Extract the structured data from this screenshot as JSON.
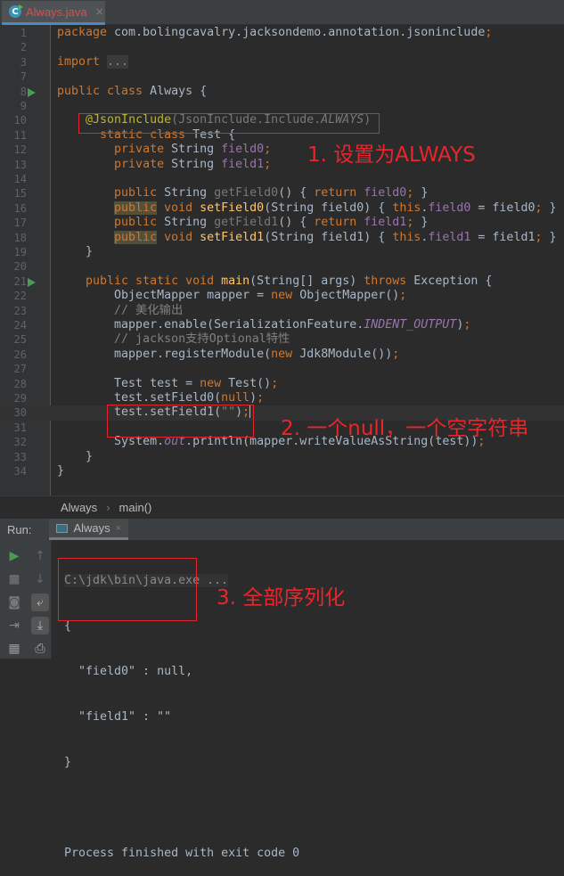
{
  "tab": {
    "filename": "Always.java",
    "close": "×",
    "icon": "class-icon"
  },
  "editor": {
    "lines": [
      {
        "n": "1",
        "t": [
          [
            "package ",
            "k"
          ],
          [
            "com.bolingcavalry.jacksondemo.annotation.jsoninclude",
            "d"
          ],
          [
            ";",
            "k"
          ]
        ]
      },
      {
        "n": "2",
        "t": []
      },
      {
        "n": "3",
        "t": [
          [
            "import ",
            "k"
          ],
          [
            "...",
            "fold"
          ]
        ]
      },
      {
        "n": "7",
        "t": []
      },
      {
        "n": "8",
        "run": true,
        "t": [
          [
            "public class ",
            "k"
          ],
          [
            "Always {",
            "d"
          ]
        ]
      },
      {
        "n": "9",
        "t": []
      },
      {
        "n": "10",
        "t": [
          [
            "    ",
            "d"
          ],
          [
            "@JsonInclude",
            "a"
          ],
          [
            "(JsonInclude.Include.",
            "g"
          ],
          [
            "ALWAYS",
            "gi"
          ],
          [
            ")",
            "g"
          ]
        ]
      },
      {
        "n": "11",
        "t": [
          [
            "      static class ",
            "k"
          ],
          [
            "Test {",
            "d"
          ]
        ]
      },
      {
        "n": "12",
        "t": [
          [
            "        private ",
            "k"
          ],
          [
            "String ",
            "d"
          ],
          [
            "field0",
            "f"
          ],
          [
            ";",
            "k"
          ]
        ]
      },
      {
        "n": "13",
        "t": [
          [
            "        private ",
            "k"
          ],
          [
            "String ",
            "d"
          ],
          [
            "field1",
            "f"
          ],
          [
            ";",
            "k"
          ]
        ]
      },
      {
        "n": "14",
        "t": []
      },
      {
        "n": "15",
        "t": [
          [
            "        public ",
            "k"
          ],
          [
            "String ",
            "d"
          ],
          [
            "getField0",
            "g"
          ],
          [
            "() { ",
            "d"
          ],
          [
            "return ",
            "k"
          ],
          [
            "field0",
            "f"
          ],
          [
            "; ",
            "k"
          ],
          [
            "}",
            "d"
          ]
        ]
      },
      {
        "n": "16",
        "t": [
          [
            "        ",
            "d"
          ],
          [
            "public",
            "k hl"
          ],
          [
            " void ",
            "k"
          ],
          [
            "setField0",
            "m"
          ],
          [
            "(String field0) { ",
            "d"
          ],
          [
            "this",
            "k"
          ],
          [
            ".",
            "d"
          ],
          [
            "field0",
            "f"
          ],
          [
            " = field0",
            "d"
          ],
          [
            "; ",
            "k"
          ],
          [
            "}",
            "d"
          ]
        ]
      },
      {
        "n": "17",
        "t": [
          [
            "        public ",
            "k"
          ],
          [
            "String ",
            "d"
          ],
          [
            "getField1",
            "g"
          ],
          [
            "() { ",
            "d"
          ],
          [
            "return ",
            "k"
          ],
          [
            "field1",
            "f"
          ],
          [
            "; ",
            "k"
          ],
          [
            "}",
            "d"
          ]
        ]
      },
      {
        "n": "18",
        "t": [
          [
            "        ",
            "d"
          ],
          [
            "public",
            "k hl"
          ],
          [
            " void ",
            "k"
          ],
          [
            "setField1",
            "m"
          ],
          [
            "(String field1) { ",
            "d"
          ],
          [
            "this",
            "k"
          ],
          [
            ".",
            "d"
          ],
          [
            "field1",
            "f"
          ],
          [
            " = field1",
            "d"
          ],
          [
            "; ",
            "k"
          ],
          [
            "}",
            "d"
          ]
        ]
      },
      {
        "n": "19",
        "t": [
          [
            "    }",
            "d"
          ]
        ]
      },
      {
        "n": "20",
        "t": []
      },
      {
        "n": "21",
        "run": true,
        "t": [
          [
            "    public static void ",
            "k"
          ],
          [
            "main",
            "m"
          ],
          [
            "(String[] args) ",
            "d"
          ],
          [
            "throws ",
            "k"
          ],
          [
            "Exception {",
            "d"
          ]
        ]
      },
      {
        "n": "22",
        "t": [
          [
            "        ObjectMapper mapper = ",
            "d"
          ],
          [
            "new ",
            "k"
          ],
          [
            "ObjectMapper()",
            "d"
          ],
          [
            ";",
            "k"
          ]
        ]
      },
      {
        "n": "23",
        "t": [
          [
            "        // 美化输出",
            "c"
          ]
        ]
      },
      {
        "n": "24",
        "t": [
          [
            "        mapper.enable(SerializationFeature.",
            "d"
          ],
          [
            "INDENT_OUTPUT",
            "fi"
          ],
          [
            ")",
            "d"
          ],
          [
            ";",
            "k"
          ]
        ]
      },
      {
        "n": "25",
        "t": [
          [
            "        // jackson支持Optional特性",
            "c"
          ]
        ]
      },
      {
        "n": "26",
        "t": [
          [
            "        mapper.registerModule(",
            "d"
          ],
          [
            "new ",
            "k"
          ],
          [
            "Jdk8Module())",
            "d"
          ],
          [
            ";",
            "k"
          ]
        ]
      },
      {
        "n": "27",
        "t": []
      },
      {
        "n": "28",
        "t": [
          [
            "        Test test = ",
            "d"
          ],
          [
            "new ",
            "k"
          ],
          [
            "Test()",
            "d"
          ],
          [
            ";",
            "k"
          ]
        ]
      },
      {
        "n": "29",
        "t": [
          [
            "        test.setField0(",
            "d"
          ],
          [
            "null",
            "k"
          ],
          [
            ")",
            "d"
          ],
          [
            ";",
            "k"
          ]
        ]
      },
      {
        "n": "30",
        "cur": true,
        "t": [
          [
            "        test.setField1(",
            "d"
          ],
          [
            "\"\"",
            "s"
          ],
          [
            ")",
            "d"
          ],
          [
            ";",
            "k"
          ]
        ]
      },
      {
        "n": "31",
        "t": []
      },
      {
        "n": "32",
        "t": [
          [
            "        System.",
            "d"
          ],
          [
            "out",
            "fi"
          ],
          [
            ".println(mapper.writeValueAsString(test))",
            "d"
          ],
          [
            ";",
            "k"
          ]
        ]
      },
      {
        "n": "33",
        "t": [
          [
            "    }",
            "d"
          ]
        ]
      },
      {
        "n": "34",
        "t": [
          [
            "}",
            "d"
          ]
        ]
      }
    ]
  },
  "annotations": {
    "note1": "1. 设置为ALWAYS",
    "note2": "2. 一个null，一个空字符串",
    "note3": "3. 全部序列化",
    "color": "#e8262b"
  },
  "breadcrumb": {
    "items": [
      "Always",
      "main()"
    ],
    "sep": "›"
  },
  "run": {
    "label": "Run:",
    "tab": "Always",
    "close": "×"
  },
  "console": {
    "lines": [
      "C:\\jdk\\bin\\java.exe ...",
      "{",
      "  \"field0\" : null,",
      "  \"field1\" : \"\"",
      "}",
      "",
      "Process finished with exit code 0"
    ]
  }
}
